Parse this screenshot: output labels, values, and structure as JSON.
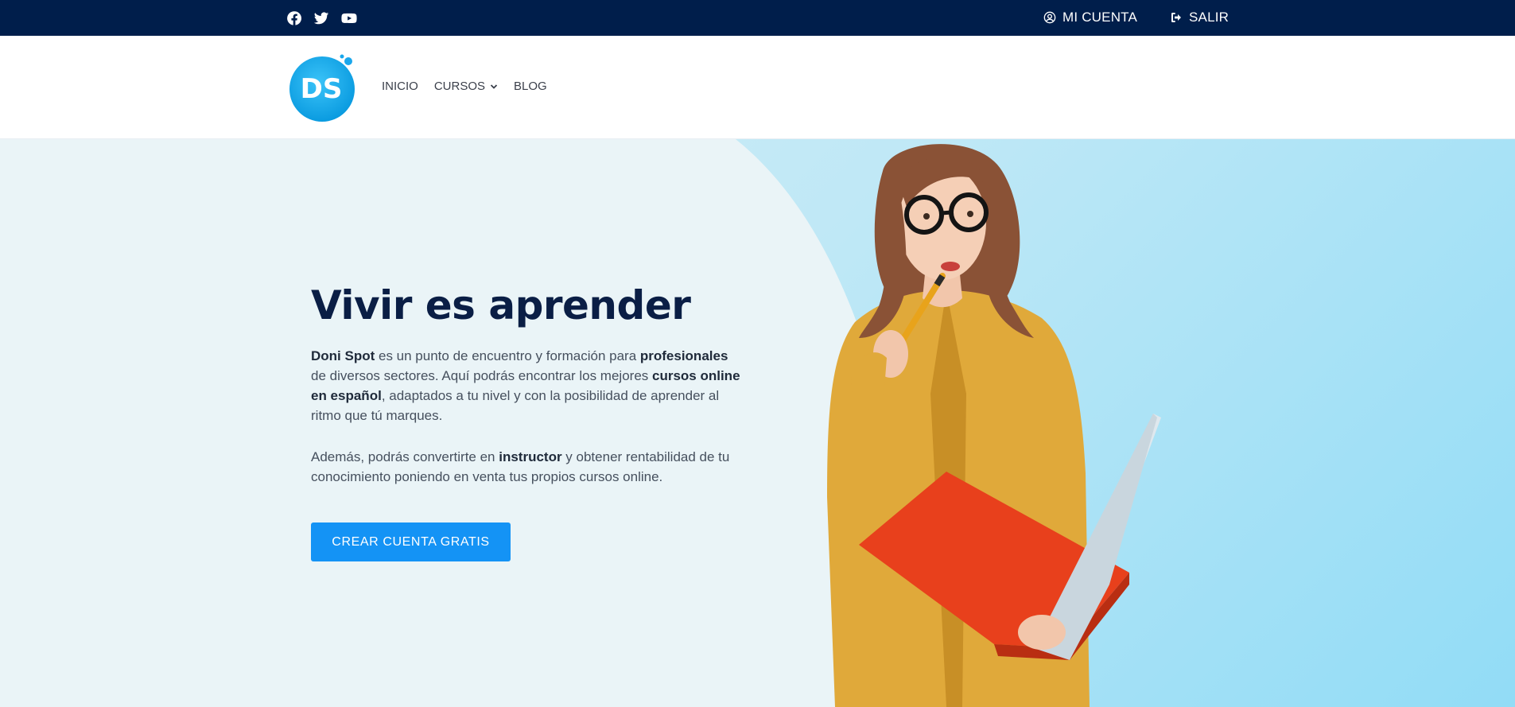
{
  "topbar": {
    "social": [
      "facebook-icon",
      "twitter-icon",
      "youtube-icon"
    ],
    "account_label": "MI CUENTA",
    "logout_label": "SALIR"
  },
  "header": {
    "logo_text": "DS",
    "nav": [
      {
        "label": "INICIO"
      },
      {
        "label": "CURSOS",
        "has_dropdown": true
      },
      {
        "label": "BLOG"
      }
    ]
  },
  "hero": {
    "title": "Vivir es aprender",
    "p1": {
      "s1_bold": "Doni Spot",
      "s2": " es un punto de encuentro y formación para ",
      "s3_bold": "profesionales",
      "s4": " de diversos sectores.  Aquí podrás encontrar los mejores ",
      "s5_bold": "cursos online en español",
      "s6": ", adaptados a tu nivel y con la posibilidad de aprender al ritmo que tú marques."
    },
    "p2": {
      "s1": "Además, podrás convertirte en ",
      "s2_bold": "instructor",
      "s3": " y obtener rentabilidad de tu conocimiento poniendo en venta tus propios cursos online."
    },
    "cta_label": "CREAR CUENTA GRATIS"
  },
  "colors": {
    "topbar": "#001e4b",
    "title": "#0a1e45",
    "cta": "#1493f5",
    "logo": "#1aa7ec"
  }
}
